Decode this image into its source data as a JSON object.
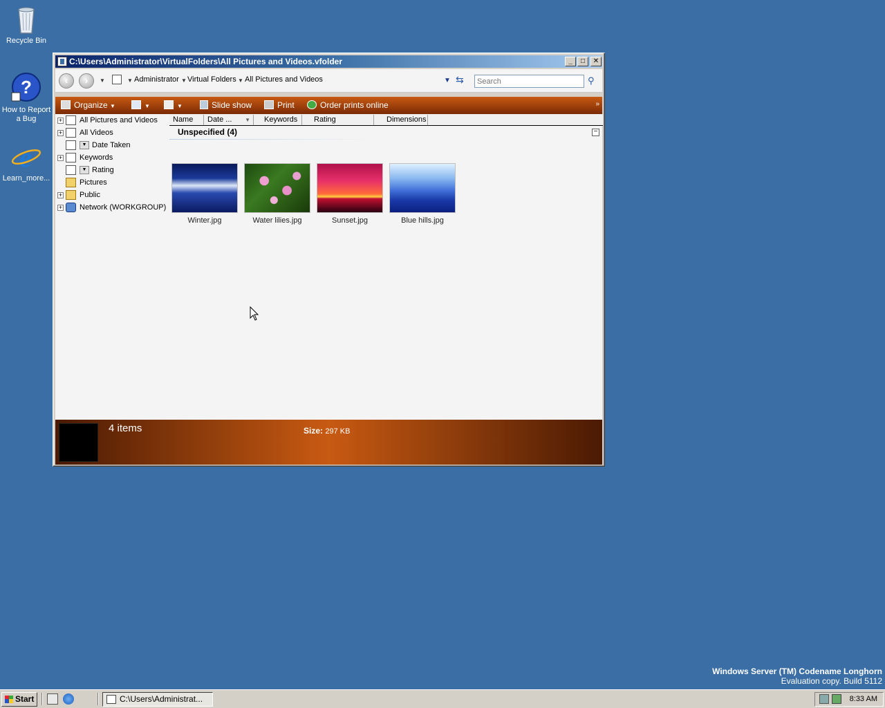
{
  "desktop": {
    "icons": [
      {
        "label": "Recycle Bin"
      },
      {
        "label": "How to Report a Bug"
      },
      {
        "label": "Learn_more..."
      }
    ],
    "watermark": {
      "line1": "Windows Server (TM) Codename Longhorn",
      "line2": "Evaluation copy. Build 5112"
    }
  },
  "window": {
    "title": "C:\\Users\\Administrator\\VirtualFolders\\All Pictures and Videos.vfolder",
    "breadcrumb": [
      "Administrator",
      "Virtual Folders",
      "All Pictures and Videos"
    ],
    "search": {
      "placeholder": "Search",
      "value": ""
    },
    "commands": {
      "organize": "Organize",
      "slideshow": "Slide show",
      "print": "Print",
      "order_prints": "Order prints online",
      "more": "»"
    },
    "tree": [
      {
        "label": "All Pictures and Videos",
        "expandable": true
      },
      {
        "label": "All Videos",
        "expandable": true
      },
      {
        "label": "Date Taken",
        "expandable": false
      },
      {
        "label": "Keywords",
        "expandable": true
      },
      {
        "label": "Rating",
        "expandable": false
      },
      {
        "label": "Pictures",
        "expandable": false
      },
      {
        "label": "Public",
        "expandable": true
      },
      {
        "label": "Network (WORKGROUP)",
        "expandable": true
      }
    ],
    "columns": [
      "Name",
      "Date ...",
      "Keywords",
      "Rating",
      "Dimensions"
    ],
    "group": {
      "title": "Unspecified (4)"
    },
    "files": [
      {
        "name": "Winter.jpg"
      },
      {
        "name": "Water lilies.jpg"
      },
      {
        "name": "Sunset.jpg"
      },
      {
        "name": "Blue hills.jpg"
      }
    ],
    "details": {
      "items_count": "4 items",
      "size_label": "Size:",
      "size_value": "297 KB"
    }
  },
  "taskbar": {
    "start_label": "Start",
    "task_label": "C:\\Users\\Administrat...",
    "clock": "8:33 AM"
  },
  "colors": {
    "desktop": "#3a6ea5",
    "command_bar": "#c85a12",
    "titlebar_start": "#0a246a"
  }
}
